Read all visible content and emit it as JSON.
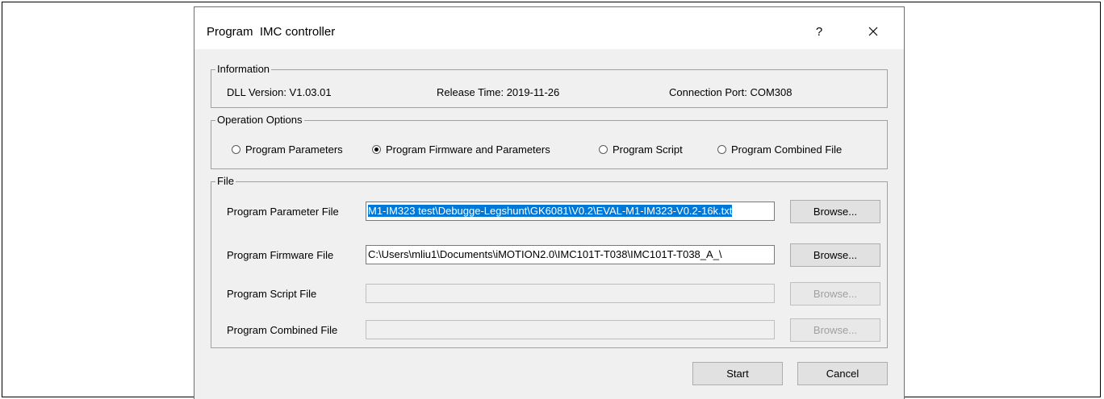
{
  "dialog": {
    "title": "Program  IMC controller",
    "help_label": "?",
    "close_icon": "close-icon"
  },
  "information": {
    "legend": "Information",
    "dll_version": "DLL Version: V1.03.01",
    "release_time": "Release Time: 2019-11-26",
    "connection_port": "Connection Port: COM308"
  },
  "operation_options": {
    "legend": "Operation Options",
    "options": [
      {
        "label": "Program Parameters",
        "checked": false
      },
      {
        "label": "Program Firmware and Parameters",
        "checked": true
      },
      {
        "label": "Program Script",
        "checked": false
      },
      {
        "label": "Program Combined File",
        "checked": false
      }
    ]
  },
  "file": {
    "legend": "File",
    "rows": [
      {
        "label": "Program Parameter File",
        "value": "M1-IM323 test\\Debugge-Legshunt\\GK6081\\V0.2\\EVAL-M1-IM323-V0.2-16k.txt",
        "browse": "Browse...",
        "enabled": true,
        "selected": true
      },
      {
        "label": "Program Firmware File",
        "value": "C:\\Users\\mliu1\\Documents\\iMOTION2.0\\IMC101T-T038\\IMC101T-T038_A_\\",
        "browse": "Browse...",
        "enabled": true,
        "selected": false
      },
      {
        "label": "Program Script File",
        "value": "",
        "browse": "Browse...",
        "enabled": false,
        "selected": false
      },
      {
        "label": "Program Combined File",
        "value": "",
        "browse": "Browse...",
        "enabled": false,
        "selected": false
      }
    ]
  },
  "actions": {
    "start": "Start",
    "cancel": "Cancel"
  }
}
